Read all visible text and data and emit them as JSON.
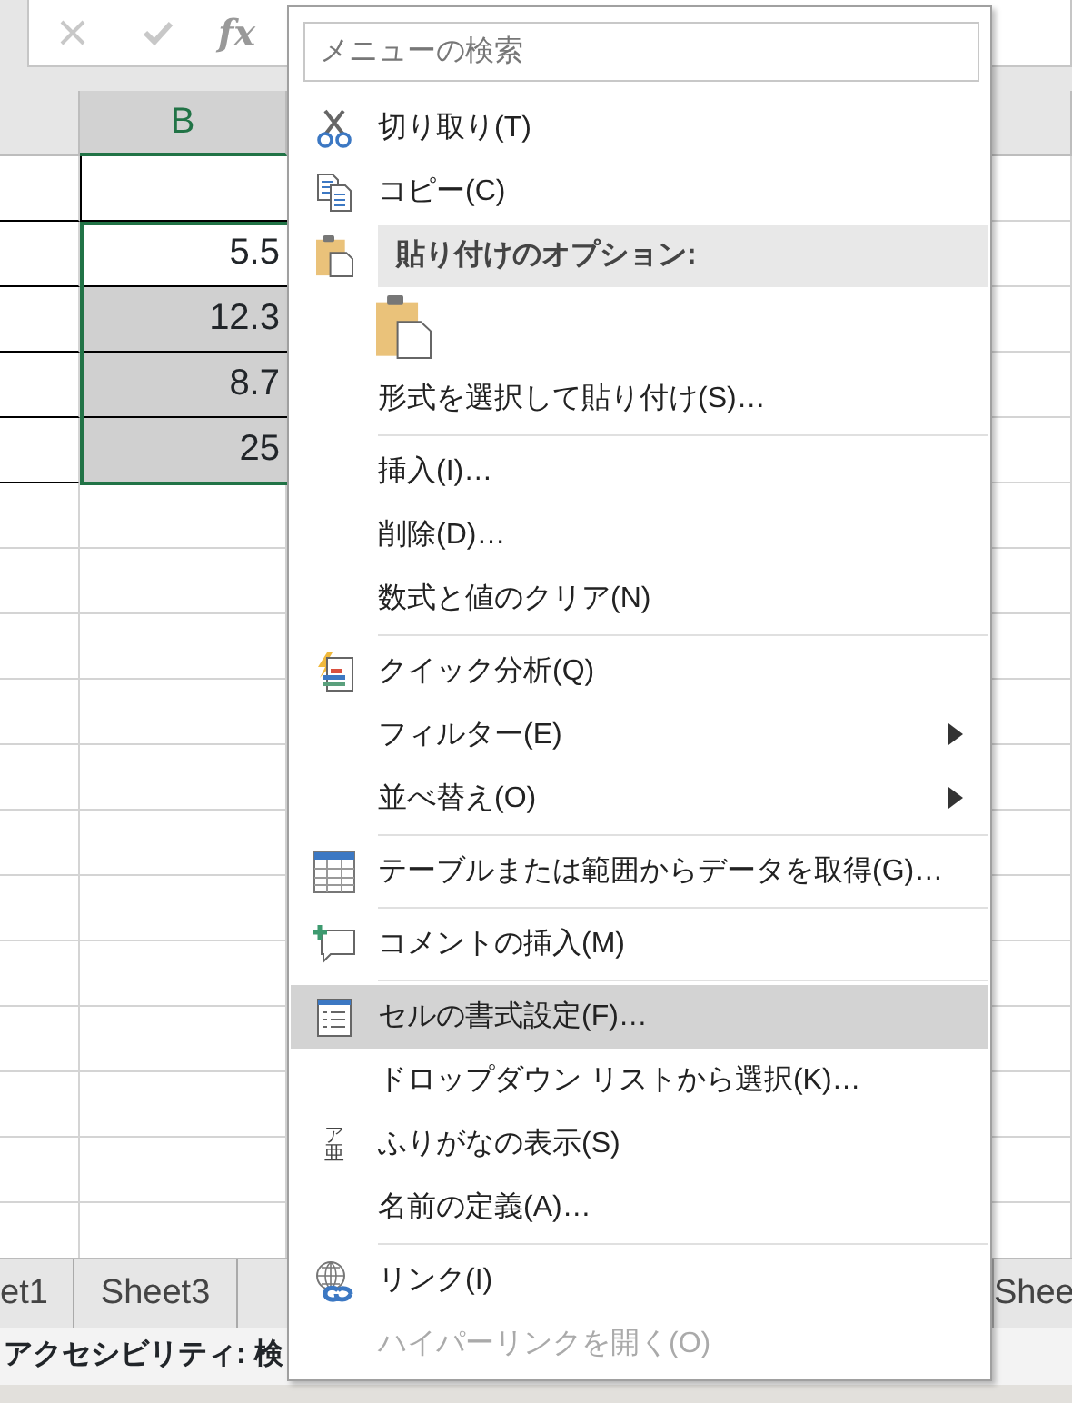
{
  "formula_bar": {
    "function_label": "fx"
  },
  "column_header": {
    "label": "B",
    "selected": true
  },
  "cells": [
    {
      "shaded": false
    },
    {
      "value": "5.5",
      "shaded": false
    },
    {
      "value": "12.3",
      "shaded": true
    },
    {
      "value": "8.7",
      "shaded": true
    },
    {
      "value": "25",
      "shaded": true
    }
  ],
  "sheet_tabs": {
    "left": [
      "et1",
      "Sheet3"
    ],
    "right": [
      "Shee"
    ]
  },
  "status_bar": {
    "text": "アクセシビリティ: 検"
  },
  "context_menu": {
    "search": {
      "placeholder": "メニューの検索"
    },
    "items": [
      {
        "kind": "item",
        "label": "切り取り(T)",
        "selected": false,
        "disabled": false,
        "submenu": false
      },
      {
        "kind": "item",
        "label": "コピー(C)",
        "selected": false,
        "disabled": false,
        "submenu": false
      },
      {
        "kind": "header",
        "label": "貼り付けのオプション:"
      },
      {
        "kind": "paste-icons"
      },
      {
        "kind": "item",
        "label": "形式を選択して貼り付け(S)…",
        "selected": false,
        "disabled": false,
        "submenu": false
      },
      {
        "kind": "separator"
      },
      {
        "kind": "item",
        "label": "挿入(I)…",
        "selected": false,
        "disabled": false,
        "submenu": false
      },
      {
        "kind": "item",
        "label": "削除(D)…",
        "selected": false,
        "disabled": false,
        "submenu": false
      },
      {
        "kind": "item",
        "label": "数式と値のクリア(N)",
        "selected": false,
        "disabled": false,
        "submenu": false
      },
      {
        "kind": "separator"
      },
      {
        "kind": "item",
        "label": "クイック分析(Q)",
        "selected": false,
        "disabled": false,
        "submenu": false
      },
      {
        "kind": "item",
        "label": "フィルター(E)",
        "selected": false,
        "disabled": false,
        "submenu": true
      },
      {
        "kind": "item",
        "label": "並べ替え(O)",
        "selected": false,
        "disabled": false,
        "submenu": true
      },
      {
        "kind": "separator"
      },
      {
        "kind": "item",
        "label": "テーブルまたは範囲からデータを取得(G)…",
        "selected": false,
        "disabled": false,
        "submenu": false
      },
      {
        "kind": "separator"
      },
      {
        "kind": "item",
        "label": "コメントの挿入(M)",
        "selected": false,
        "disabled": false,
        "submenu": false
      },
      {
        "kind": "separator"
      },
      {
        "kind": "item",
        "label": "セルの書式設定(F)…",
        "selected": true,
        "disabled": false,
        "submenu": false
      },
      {
        "kind": "item",
        "label": "ドロップダウン リストから選択(K)…",
        "selected": false,
        "disabled": false,
        "submenu": false
      },
      {
        "kind": "item",
        "label": "ふりがなの表示(S)",
        "selected": false,
        "disabled": false,
        "submenu": false,
        "icon_glyphs": [
          "ア",
          "亜"
        ]
      },
      {
        "kind": "item",
        "label": "名前の定義(A)…",
        "selected": false,
        "disabled": false,
        "submenu": false
      },
      {
        "kind": "separator"
      },
      {
        "kind": "item",
        "label": "リンク(I)",
        "selected": false,
        "disabled": false,
        "submenu": false
      },
      {
        "kind": "item",
        "label": "ハイパーリンクを開く(O)",
        "selected": false,
        "disabled": true,
        "submenu": false
      }
    ]
  }
}
